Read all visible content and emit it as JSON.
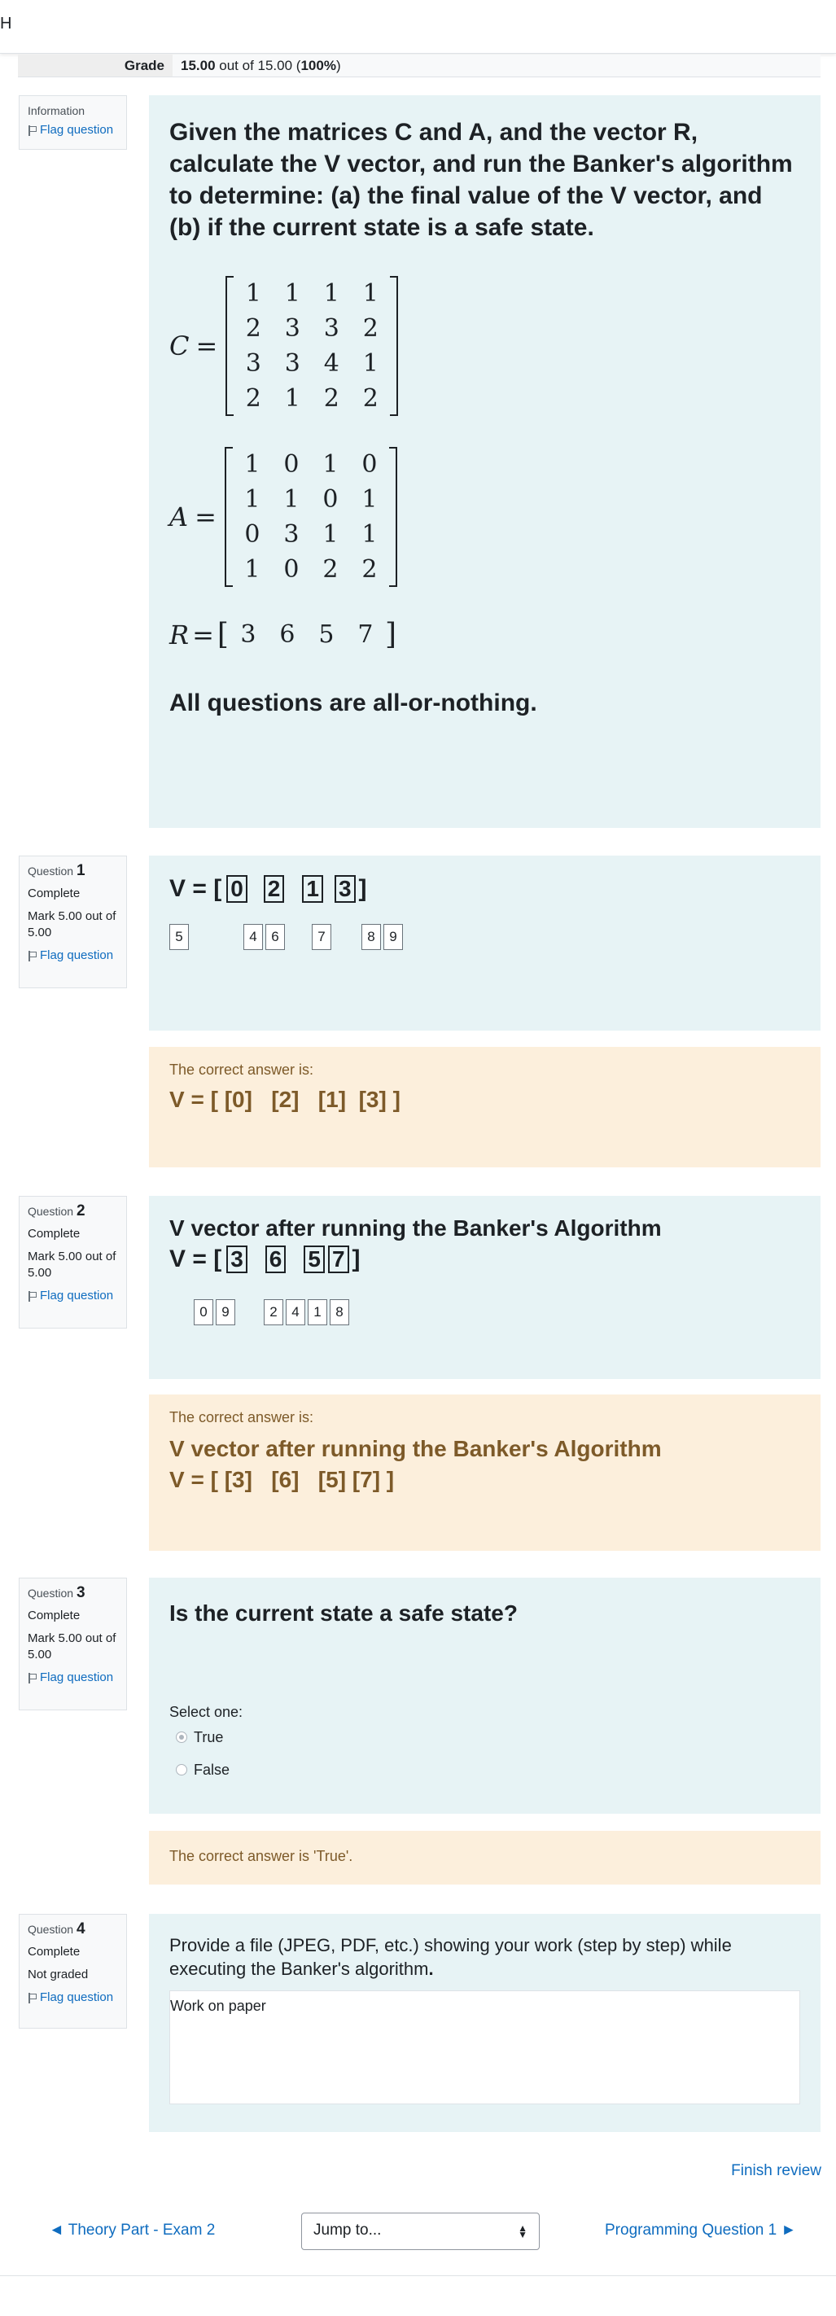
{
  "header": {
    "edge_char": "H"
  },
  "summary": {
    "grade_label": "Grade",
    "grade_value": "15.00",
    "grade_rest": " out of 15.00 (",
    "grade_percent": "100%",
    "grade_close": ")"
  },
  "info": {
    "label": "Information",
    "flag": "Flag question",
    "heading": "Given the matrices C and A, and the vector R, calculate the V vector, and run the Banker's algorithm to determine: (a) the final value of the V vector, and (b) if the current state is a safe state.",
    "matrix_C_label": "C",
    "matrix_C": [
      [
        1,
        1,
        1,
        1
      ],
      [
        2,
        3,
        3,
        2
      ],
      [
        3,
        3,
        4,
        1
      ],
      [
        2,
        1,
        2,
        2
      ]
    ],
    "matrix_A_label": "A",
    "matrix_A": [
      [
        1,
        0,
        1,
        0
      ],
      [
        1,
        1,
        0,
        1
      ],
      [
        0,
        3,
        1,
        1
      ],
      [
        1,
        0,
        2,
        2
      ]
    ],
    "vector_R_label": "R",
    "vector_R": [
      3,
      6,
      5,
      7
    ],
    "footer": "All questions are all-or-nothing."
  },
  "questions": [
    {
      "prefix": "Question",
      "number": "1",
      "state": "Complete",
      "mark": "Mark 5.00 out of 5.00",
      "flag": "Flag question",
      "answer_prefix": "V = [",
      "answer_suffix": "]",
      "answers": [
        "0",
        "2",
        "1",
        "3"
      ],
      "chips": [
        "5",
        "4",
        "6",
        "7",
        "8",
        "9"
      ],
      "fb_label": "The correct answer is:",
      "fb_answer": "V = [ [0]   [2]   [1]  [3] ]"
    },
    {
      "prefix": "Question",
      "number": "2",
      "state": "Complete",
      "mark": "Mark 5.00 out of 5.00",
      "flag": "Flag question",
      "title": "V vector after running the Banker's Algorithm",
      "answer_prefix": "V = [",
      "answer_suffix": "]",
      "answers": [
        "3",
        "6",
        "5",
        "7"
      ],
      "chips": [
        "0",
        "9",
        "2",
        "4",
        "1",
        "8"
      ],
      "fb_label": "The correct answer is:",
      "fb_title": "V vector after running the Banker's Algorithm",
      "fb_answer": "V = [ [3]   [6]   [5] [7] ]"
    },
    {
      "prefix": "Question",
      "number": "3",
      "state": "Complete",
      "mark": "Mark 5.00 out of 5.00",
      "flag": "Flag question",
      "title": "Is the current state a safe state?",
      "select_one": "Select one:",
      "options": [
        "True",
        "False"
      ],
      "selected": "True",
      "fb_text": "The correct answer is 'True'."
    },
    {
      "prefix": "Question",
      "number": "4",
      "state": "Complete",
      "mark": "Not graded",
      "flag": "Flag question",
      "prompt": "Provide a file (JPEG, PDF, etc.) showing your work (step by step) while executing the Banker's algorithm",
      "prompt_end": ".",
      "response": "Work on paper"
    }
  ],
  "footer": {
    "finish_review": "Finish review",
    "prev_link": "◄ Theory Part - Exam 2",
    "jump_to": "Jump to...",
    "next_link": "Programming Question 1 ►"
  }
}
